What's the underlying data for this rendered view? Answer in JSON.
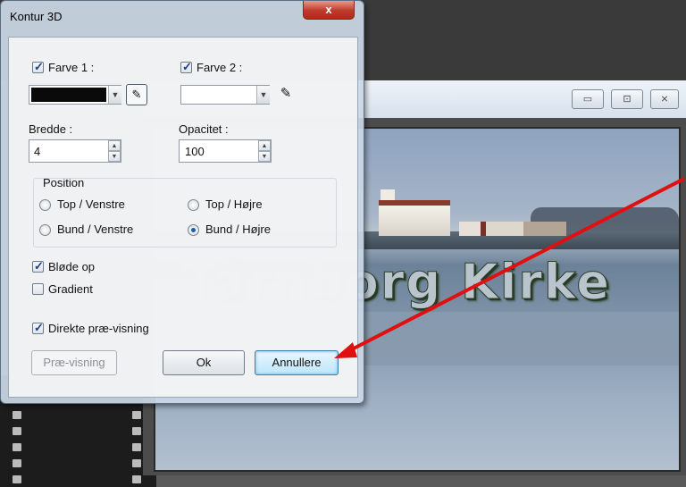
{
  "dialog": {
    "title": "Kontur 3D",
    "close_label": "x",
    "color1": {
      "label": "Farve 1 :",
      "checked": true,
      "swatch": "#0a0a0a"
    },
    "color2": {
      "label": "Farve 2 :",
      "checked": true,
      "swatch": "#ffffff"
    },
    "width": {
      "label": "Bredde :",
      "value": "4"
    },
    "opacity": {
      "label": "Opacitet :",
      "value": "100"
    },
    "position": {
      "legend": "Position",
      "options": [
        {
          "label": "Top / Venstre",
          "selected": false
        },
        {
          "label": "Top / Højre",
          "selected": false
        },
        {
          "label": "Bund / Venstre",
          "selected": false
        },
        {
          "label": "Bund / Højre",
          "selected": true
        }
      ]
    },
    "soften": {
      "label": "Bløde op",
      "checked": true
    },
    "gradient": {
      "label": "Gradient",
      "checked": false
    },
    "direct_preview": {
      "label": "Direkte præ-visning",
      "checked": true
    },
    "buttons": {
      "preview": "Præ-visning",
      "ok": "Ok",
      "cancel": "Annullere"
    }
  },
  "background": {
    "photo_text": "Tårnborg Kirke",
    "window_buttons": {
      "minimize": "▭",
      "maximize": "⊡",
      "close": "⨯"
    }
  },
  "annotation": {
    "arrow_color": "#e01010"
  }
}
